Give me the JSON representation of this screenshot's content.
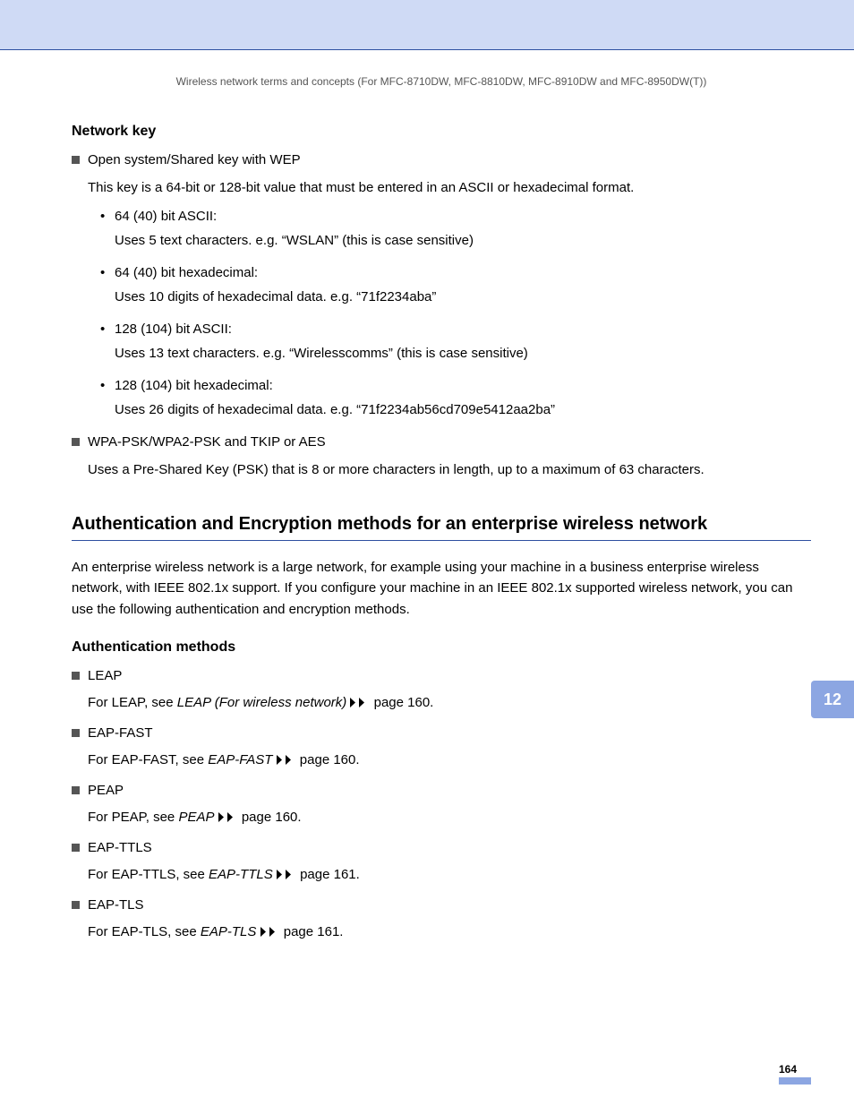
{
  "runningHead": "Wireless network terms and concepts (For MFC-8710DW, MFC-8810DW, MFC-8910DW and MFC-8950DW(T))",
  "chapterTab": "12",
  "pageNumber": "164",
  "section1": {
    "heading": "Network key",
    "item1": {
      "title": "Open system/Shared key with WEP",
      "intro": "This key is a 64-bit or 128-bit value that must be entered in an ASCII or hexadecimal format.",
      "subs": [
        {
          "label": "64 (40) bit ASCII:",
          "body": "Uses 5 text characters. e.g. “WSLAN” (this is case sensitive)"
        },
        {
          "label": "64 (40) bit hexadecimal:",
          "body": "Uses 10 digits of hexadecimal data. e.g. “71f2234aba”"
        },
        {
          "label": "128 (104) bit ASCII:",
          "body": "Uses 13 text characters. e.g. “Wirelesscomms” (this is case sensitive)"
        },
        {
          "label": "128 (104) bit hexadecimal:",
          "body": "Uses 26 digits of hexadecimal data. e.g. “71f2234ab56cd709e5412aa2ba”"
        }
      ]
    },
    "item2": {
      "title": "WPA-PSK/WPA2-PSK and TKIP or AES",
      "body": "Uses a Pre-Shared Key (PSK) that is 8 or more characters in length, up to a maximum of 63 characters."
    }
  },
  "section2": {
    "heading": "Authentication and Encryption methods for an enterprise wireless network",
    "intro": "An enterprise wireless network is a large network, for example using your machine in a business enterprise wireless network, with IEEE 802.1x support. If you configure your machine in an IEEE 802.1x supported wireless network, you can use the following authentication and encryption methods.",
    "subHeading": "Authentication methods",
    "methods": [
      {
        "name": "LEAP",
        "pre": "For LEAP, see ",
        "linkText": "LEAP (For wireless network)",
        "page": " page 160."
      },
      {
        "name": "EAP-FAST",
        "pre": "For EAP-FAST, see ",
        "linkText": "EAP-FAST",
        "page": " page 160."
      },
      {
        "name": "PEAP",
        "pre": "For PEAP, see ",
        "linkText": "PEAP",
        "page": " page 160."
      },
      {
        "name": "EAP-TTLS",
        "pre": "For EAP-TTLS, see ",
        "linkText": "EAP-TTLS",
        "page": " page 161."
      },
      {
        "name": "EAP-TLS",
        "pre": "For EAP-TLS, see ",
        "linkText": "EAP-TLS",
        "page": " page 161."
      }
    ]
  }
}
